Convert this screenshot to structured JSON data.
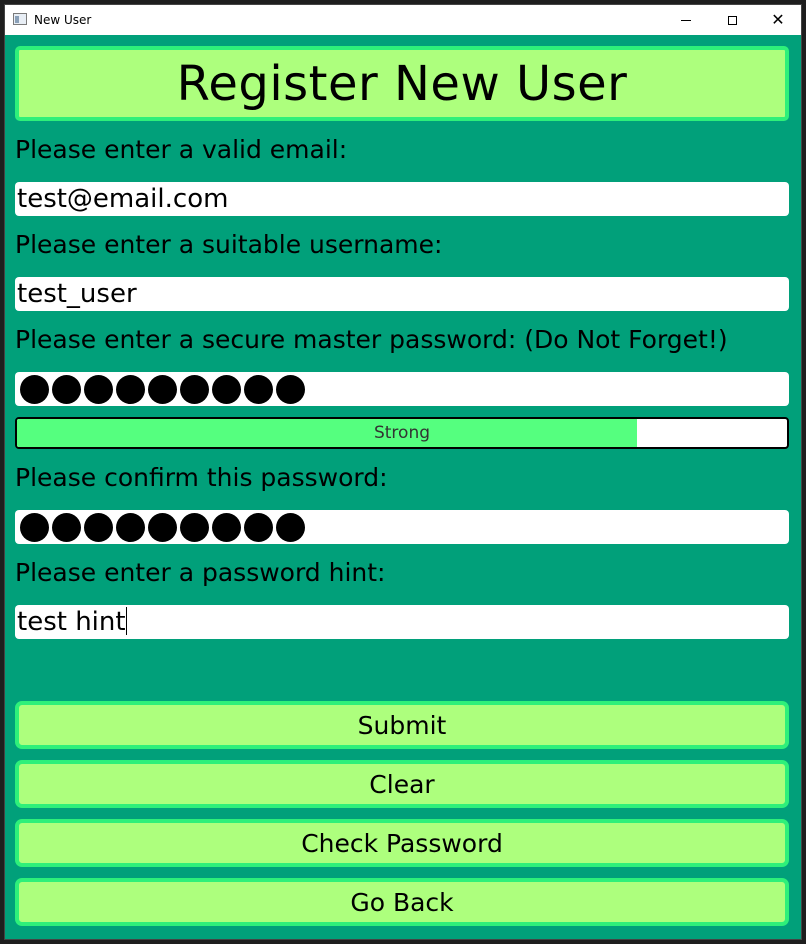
{
  "window": {
    "title": "New User",
    "minimize_icon": "minimize-icon",
    "maximize_icon": "maximize-icon",
    "close_icon": "close-icon",
    "close_glyph": "✕"
  },
  "header": {
    "title": "Register New User"
  },
  "form": {
    "email_label": "Please enter a valid email:",
    "email_value": "test@email.com",
    "username_label": "Please enter a suitable username:",
    "username_value": "test_user",
    "password_label": "Please enter a secure master password:   (Do Not Forget!)",
    "password_mask_count": 9,
    "strength_label": "Strong",
    "strength_fraction": 0.805,
    "confirm_label": "Please confirm this password:",
    "confirm_mask_count": 9,
    "hint_label": "Please enter a password hint:",
    "hint_value": "test hint"
  },
  "buttons": {
    "submit": "Submit",
    "clear": "Clear",
    "check_password": "Check Password",
    "go_back": "Go Back"
  },
  "colors": {
    "background": "#01a07a",
    "button_fill": "#adff7d",
    "button_border": "#2ef07a",
    "strength_fill": "#55ff7f"
  }
}
